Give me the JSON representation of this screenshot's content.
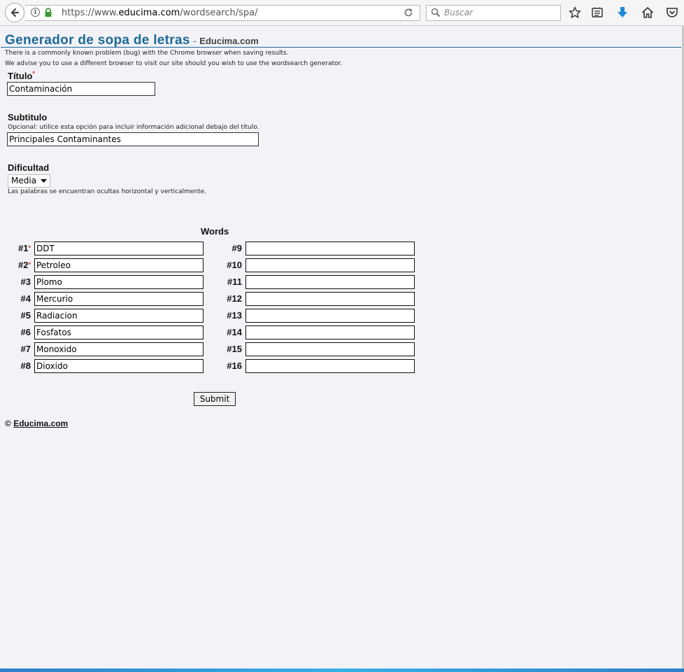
{
  "browser": {
    "url_prefix": "https://www.",
    "url_host": "educima.com",
    "url_path": "/wordsearch/spa/",
    "search_placeholder": "Buscar"
  },
  "header": {
    "title": "Generador de sopa de letras",
    "dash": "-",
    "site": "Educima.com"
  },
  "notice": {
    "line1": "There is a commonly known problem (bug) with the Chrome browser when saving results.",
    "line2": "We advise you to use a different browser to visit our site should you wish to use the wordsearch generator."
  },
  "form": {
    "title_label": "Título",
    "required_mark": "*",
    "title_value": "Contaminación",
    "subtitle_label": "Subtitulo",
    "subtitle_hint": "Opcional: utilice esta opción para incluir información adicional debajo del título.",
    "subtitle_value": "Principales Contaminantes",
    "difficulty_label": "Dificultad",
    "difficulty_value": "Media",
    "difficulty_hint": "Las palabras se encuentran ocultas horizontal y verticalmente.",
    "words_title": "Words",
    "submit_label": "Submit"
  },
  "words": [
    {
      "num": "#1",
      "value": "DDT",
      "required": true
    },
    {
      "num": "#2",
      "value": "Petroleo",
      "required": true
    },
    {
      "num": "#3",
      "value": "Plomo"
    },
    {
      "num": "#4",
      "value": "Mercurio"
    },
    {
      "num": "#5",
      "value": "Radiacion"
    },
    {
      "num": "#6",
      "value": "Fosfatos"
    },
    {
      "num": "#7",
      "value": "Monoxido"
    },
    {
      "num": "#8",
      "value": "Dioxido"
    },
    {
      "num": "#9",
      "value": ""
    },
    {
      "num": "#10",
      "value": ""
    },
    {
      "num": "#11",
      "value": ""
    },
    {
      "num": "#12",
      "value": ""
    },
    {
      "num": "#13",
      "value": ""
    },
    {
      "num": "#14",
      "value": ""
    },
    {
      "num": "#15",
      "value": ""
    },
    {
      "num": "#16",
      "value": ""
    }
  ],
  "footer": {
    "copyright": "©",
    "link": "Educima.com"
  },
  "colors": {
    "title_blue": "#1c6a96",
    "required_red": "#c0392b",
    "download_blue": "#1e8ad6"
  }
}
